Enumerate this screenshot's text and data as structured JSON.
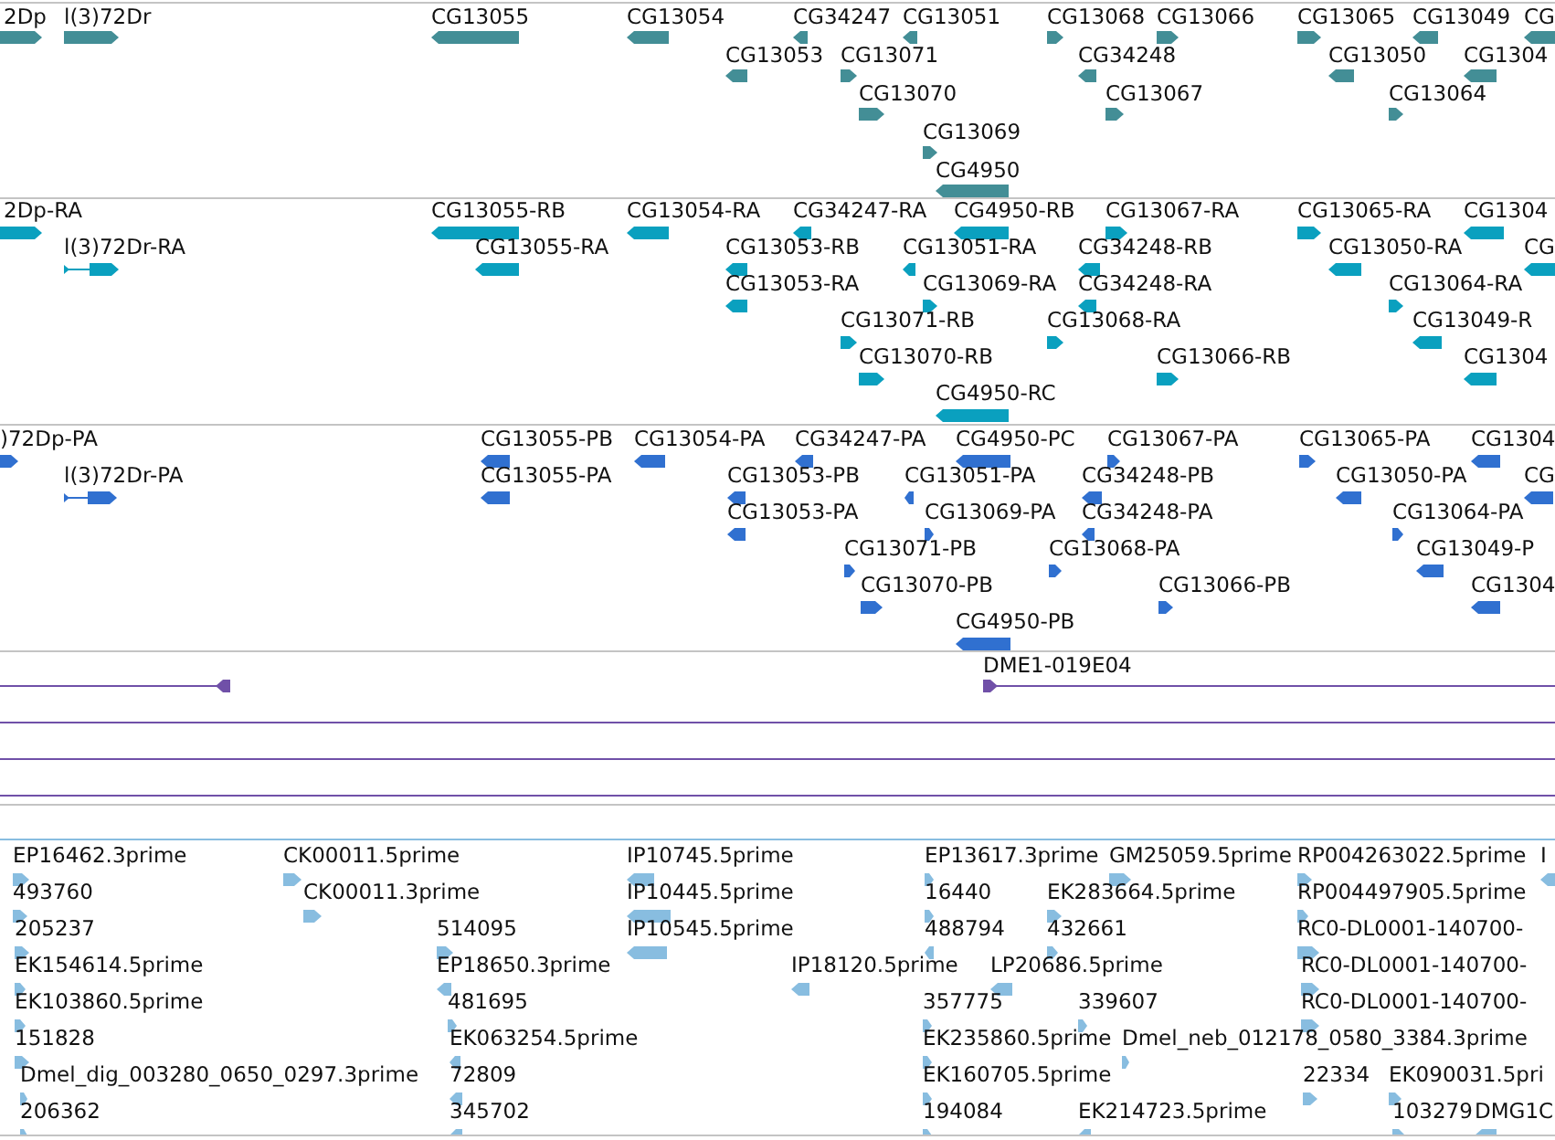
{
  "tracks": [
    {
      "kind": "gene",
      "color": "#438e96",
      "features": [
        {
          "label": "2Dp",
          "reverse": false
        },
        {
          "label": "l(3)72Dr",
          "reverse": false
        },
        {
          "label": "CG13055",
          "reverse": true
        },
        {
          "label": "CG13054",
          "reverse": true
        },
        {
          "label": "CG34247",
          "reverse": true
        },
        {
          "label": "CG13051",
          "reverse": true
        },
        {
          "label": "CG13068",
          "reverse": false
        },
        {
          "label": "CG13066",
          "reverse": false
        },
        {
          "label": "CG13065",
          "reverse": false
        },
        {
          "label": "CG13049",
          "reverse": true
        },
        {
          "label": "CG",
          "reverse": true
        },
        {
          "label": "CG13053",
          "reverse": true
        },
        {
          "label": "CG13071",
          "reverse": false
        },
        {
          "label": "CG34248",
          "reverse": true
        },
        {
          "label": "CG13050",
          "reverse": true
        },
        {
          "label": "CG1304",
          "reverse": true
        },
        {
          "label": "CG13070",
          "reverse": false
        },
        {
          "label": "CG13067",
          "reverse": false
        },
        {
          "label": "CG13064",
          "reverse": false
        },
        {
          "label": "CG13069",
          "reverse": false
        },
        {
          "label": "CG4950",
          "reverse": true
        }
      ]
    },
    {
      "kind": "transcript",
      "color": "#0aa0bf",
      "features": [
        {
          "label": "2Dp-RA",
          "reverse": false
        },
        {
          "label": "CG13055-RB",
          "reverse": true
        },
        {
          "label": "CG13054-RA",
          "reverse": true
        },
        {
          "label": "CG34247-RA",
          "reverse": true
        },
        {
          "label": "CG4950-RB",
          "reverse": true
        },
        {
          "label": "CG13067-RA",
          "reverse": false
        },
        {
          "label": "CG13065-RA",
          "reverse": false
        },
        {
          "label": "CG1304",
          "reverse": true
        },
        {
          "label": "l(3)72Dr-RA",
          "reverse": false,
          "spliced": true
        },
        {
          "label": "CG13055-RA",
          "reverse": true
        },
        {
          "label": "CG13053-RB",
          "reverse": true
        },
        {
          "label": "CG13051-RA",
          "reverse": true
        },
        {
          "label": "CG34248-RB",
          "reverse": true
        },
        {
          "label": "CG13050-RA",
          "reverse": true
        },
        {
          "label": "CG",
          "reverse": true
        },
        {
          "label": "CG13053-RA",
          "reverse": true
        },
        {
          "label": "CG13069-RA",
          "reverse": false
        },
        {
          "label": "CG34248-RA",
          "reverse": true
        },
        {
          "label": "CG13064-RA",
          "reverse": false
        },
        {
          "label": "CG13071-RB",
          "reverse": false
        },
        {
          "label": "CG13068-RA",
          "reverse": false
        },
        {
          "label": "CG13049-R",
          "reverse": true
        },
        {
          "label": "CG13070-RB",
          "reverse": false
        },
        {
          "label": "CG13066-RB",
          "reverse": false
        },
        {
          "label": "CG1304",
          "reverse": true
        },
        {
          "label": "CG4950-RC",
          "reverse": true
        }
      ]
    },
    {
      "kind": "protein",
      "color": "#3070d0",
      "features": [
        {
          "label": ")72Dp-PA",
          "reverse": false
        },
        {
          "label": "CG13055-PB",
          "reverse": true
        },
        {
          "label": "CG13054-PA",
          "reverse": true
        },
        {
          "label": "CG34247-PA",
          "reverse": true
        },
        {
          "label": "CG4950-PC",
          "reverse": true
        },
        {
          "label": "CG13067-PA",
          "reverse": false
        },
        {
          "label": "CG13065-PA",
          "reverse": false
        },
        {
          "label": "CG1304",
          "reverse": true
        },
        {
          "label": "l(3)72Dr-PA",
          "reverse": false,
          "spliced": true
        },
        {
          "label": "CG13055-PA",
          "reverse": true
        },
        {
          "label": "CG13053-PB",
          "reverse": true
        },
        {
          "label": "CG13051-PA",
          "reverse": true
        },
        {
          "label": "CG34248-PB",
          "reverse": true
        },
        {
          "label": "CG13050-PA",
          "reverse": true
        },
        {
          "label": "CG",
          "reverse": true
        },
        {
          "label": "CG13053-PA",
          "reverse": true
        },
        {
          "label": "CG13069-PA",
          "reverse": false
        },
        {
          "label": "CG34248-PA",
          "reverse": true
        },
        {
          "label": "CG13064-PA",
          "reverse": false
        },
        {
          "label": "CG13071-PB",
          "reverse": false
        },
        {
          "label": "CG13068-PA",
          "reverse": false
        },
        {
          "label": "CG13049-P",
          "reverse": true
        },
        {
          "label": "CG13070-PB",
          "reverse": false
        },
        {
          "label": "CG13066-PB",
          "reverse": false
        },
        {
          "label": "CG1304",
          "reverse": true
        },
        {
          "label": "CG4950-PB",
          "reverse": true
        }
      ]
    },
    {
      "kind": "clone",
      "color": "#7050a8",
      "features": [
        {
          "kind": "arrow",
          "reverse": true
        },
        {
          "kind": "arrow",
          "label": "DME1-019E04",
          "reverse": false
        },
        {
          "kind": "span"
        },
        {
          "kind": "span"
        },
        {
          "kind": "span"
        }
      ]
    },
    {
      "kind": "est",
      "color": "#88bde0",
      "features": [
        {
          "label": "EP16462.3prime",
          "reverse": false
        },
        {
          "label": "CK00011.5prime",
          "reverse": false
        },
        {
          "label": "IP10745.5prime",
          "reverse": true
        },
        {
          "label": "EP13617.3prime",
          "reverse": false
        },
        {
          "label": "GM25059.5prime",
          "reverse": false
        },
        {
          "label": "RP004263022.5prime",
          "reverse": false
        },
        {
          "label": "I",
          "reverse": true
        },
        {
          "label": "493760",
          "reverse": false
        },
        {
          "label": "CK00011.3prime",
          "reverse": false
        },
        {
          "label": "IP10445.5prime",
          "reverse": true
        },
        {
          "label": "16440",
          "reverse": false
        },
        {
          "label": "EK283664.5prime",
          "reverse": false
        },
        {
          "label": "RP004497905.5prime",
          "reverse": false
        },
        {
          "label": "205237",
          "reverse": false
        },
        {
          "label": "514095",
          "reverse": false
        },
        {
          "label": "IP10545.5prime",
          "reverse": true
        },
        {
          "label": "488794",
          "reverse": true
        },
        {
          "label": "432661",
          "reverse": false
        },
        {
          "label": "RC0-DL0001-140700-",
          "reverse": false
        },
        {
          "label": "EK154614.5prime",
          "reverse": false
        },
        {
          "label": "EP18650.3prime",
          "reverse": true
        },
        {
          "label": "IP18120.5prime",
          "reverse": true
        },
        {
          "label": "LP20686.5prime",
          "reverse": true
        },
        {
          "label": "RC0-DL0001-140700-",
          "reverse": false
        },
        {
          "label": "EK103860.5prime",
          "reverse": false
        },
        {
          "label": "481695",
          "reverse": false
        },
        {
          "label": "357775",
          "reverse": false
        },
        {
          "label": "339607",
          "reverse": false
        },
        {
          "label": "RC0-DL0001-140700-",
          "reverse": false
        },
        {
          "label": "151828",
          "reverse": false
        },
        {
          "label": "EK063254.5prime",
          "reverse": true
        },
        {
          "label": "EK235860.5prime",
          "reverse": false
        },
        {
          "label": "Dmel_neb_012178_0580_3384.3prime",
          "reverse": false
        },
        {
          "label": "Dmel_dig_003280_0650_0297.3prime",
          "reverse": false
        },
        {
          "label": "72809",
          "reverse": true
        },
        {
          "label": "EK160705.5prime",
          "reverse": false
        },
        {
          "label": "22334",
          "reverse": false
        },
        {
          "label": "EK090031.5pri",
          "reverse": false
        },
        {
          "label": "206362",
          "reverse": false
        },
        {
          "label": "345702",
          "reverse": true
        },
        {
          "label": "194084",
          "reverse": false
        },
        {
          "label": "EK214723.5prime",
          "reverse": true
        },
        {
          "label": "103279",
          "reverse": false
        },
        {
          "label": "DMG1C",
          "reverse": true
        }
      ]
    }
  ]
}
